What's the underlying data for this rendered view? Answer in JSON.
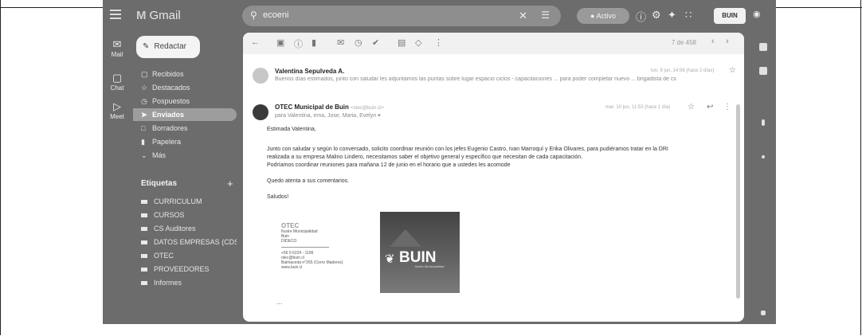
{
  "app": {
    "name": "Gmail"
  },
  "search": {
    "query": "ecoeni"
  },
  "status": {
    "label": "Activo"
  },
  "account": {
    "label": "BUIN"
  },
  "rail": [
    {
      "label": "Mail"
    },
    {
      "label": "Chat"
    },
    {
      "label": "Meet"
    }
  ],
  "compose": {
    "label": "Redactar"
  },
  "nav": [
    {
      "label": "Recibidos",
      "icon": "inbox-icon"
    },
    {
      "label": "Destacados",
      "icon": "star-icon"
    },
    {
      "label": "Pospuestos",
      "icon": "clock-icon"
    },
    {
      "label": "Enviados",
      "icon": "send-icon"
    },
    {
      "label": "Borradores",
      "icon": "draft-icon"
    },
    {
      "label": "Papelera",
      "icon": "trash-icon"
    },
    {
      "label": "Más",
      "icon": "chevron-down-icon"
    }
  ],
  "labels": {
    "title": "Etiquetas",
    "items": [
      "CURRICULUM",
      "CURSOS",
      "CS Auditores",
      "DATOS EMPRESAS (CDS...",
      "OTEC",
      "PROVEEDORES",
      "Informes"
    ]
  },
  "toolbar": {
    "pager": "7 de 458"
  },
  "messages": [
    {
      "sender": "Valentina Sepulveda A.",
      "snippet": "Buenos días estimados, junto con saludar les adjuntamos las puntas sobre lugar espacio ciclos - capacitaciones ... para poder completar nuevo ... brigadista de cs",
      "meta": "lun, 9 jun, 14:56 (hace 2 días)"
    },
    {
      "sender": "OTEC Municipal de Buin",
      "from_email": "<otec@buin.cl>",
      "to": "para Valentina, ema, Jose, Maria, Evelyn",
      "meta": "mar, 10 jun, 11:53 (hace 1 día)",
      "greeting": "Estimada Valentina,",
      "body": [
        "Junto con saludar y según lo conversado, solicito coordinar reunión con los jefes Eugenio Castro, Ivan Marroquí y Erika Olivares, para pudiéramos tratar en la DRI",
        "realizada a su empresa Malino Lindero, necesitamos saber el objetivo general y específico que necesitan de cada capacitación.",
        "Podríamos coordinar reuniones para mañana 12 de junio en el horario que a ustedes les acomode"
      ],
      "closing": "Quedo atenta a sus comentarios.",
      "signoff": "Saludos!",
      "signature": {
        "org": "OTEC",
        "lines": [
          "Ilustre Municipalidad",
          "Buin",
          "DIDECO"
        ],
        "contact": [
          "+56 9 6224 - 1196",
          "otec@buin.cl",
          "Balmaceda n°265 (Cerro Maderos)",
          "www.buin.cl"
        ],
        "brand": "BUIN",
        "brand_sub": "Ilustre Municipalidad"
      },
      "trimmed": "..."
    }
  ]
}
